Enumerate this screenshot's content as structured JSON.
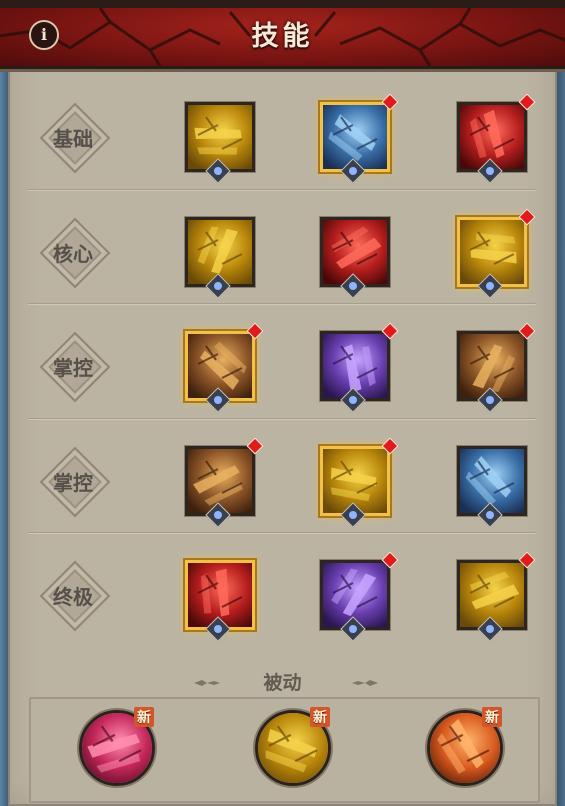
{
  "header": {
    "title": "技能",
    "info_label": "i"
  },
  "rows": [
    {
      "label": "基础",
      "skills": [
        {
          "name": "skill-golden-axe",
          "theme": "gold",
          "selected": false,
          "new_dot": false
        },
        {
          "name": "skill-ice-slash",
          "theme": "blue",
          "selected": true,
          "new_dot": true
        },
        {
          "name": "skill-red-strike",
          "theme": "red",
          "selected": false,
          "new_dot": true
        }
      ]
    },
    {
      "label": "核心",
      "skills": [
        {
          "name": "skill-golden-whirl",
          "theme": "gold",
          "selected": false,
          "new_dot": false
        },
        {
          "name": "skill-red-claw",
          "theme": "red",
          "selected": false,
          "new_dot": false
        },
        {
          "name": "skill-hammer-burst",
          "theme": "gold",
          "selected": true,
          "new_dot": true
        }
      ]
    },
    {
      "label": "掌控",
      "skills": [
        {
          "name": "skill-fire-comet",
          "theme": "brown",
          "selected": true,
          "new_dot": true
        },
        {
          "name": "skill-purple-burst",
          "theme": "purple",
          "selected": false,
          "new_dot": true
        },
        {
          "name": "skill-lightning-wall",
          "theme": "brown",
          "selected": false,
          "new_dot": true
        }
      ]
    },
    {
      "label": "掌控",
      "skills": [
        {
          "name": "skill-ground-slam",
          "theme": "brown",
          "selected": false,
          "new_dot": true
        },
        {
          "name": "skill-war-cry",
          "theme": "gold",
          "selected": true,
          "new_dot": true
        },
        {
          "name": "skill-frost-shout",
          "theme": "blue",
          "selected": false,
          "new_dot": false
        }
      ]
    },
    {
      "label": "终极",
      "skills": [
        {
          "name": "skill-blood-spear",
          "theme": "red",
          "selected": true,
          "new_dot": false
        },
        {
          "name": "skill-demon-summon",
          "theme": "purple",
          "selected": false,
          "new_dot": true
        },
        {
          "name": "skill-golden-rage",
          "theme": "gold",
          "selected": false,
          "new_dot": true
        }
      ]
    }
  ],
  "passive": {
    "title": "被动",
    "skills": [
      {
        "name": "passive-heart",
        "theme": "pink",
        "new_label": "新"
      },
      {
        "name": "passive-golden-axe",
        "theme": "gold",
        "new_label": "新"
      },
      {
        "name": "passive-fire-feather",
        "theme": "orange",
        "new_label": "新"
      }
    ]
  },
  "colors": {
    "header_red": "#8a1a14",
    "panel": "#bcb4a3",
    "selected_border": "#f2c14a",
    "new_dot": "#e01b1b"
  }
}
